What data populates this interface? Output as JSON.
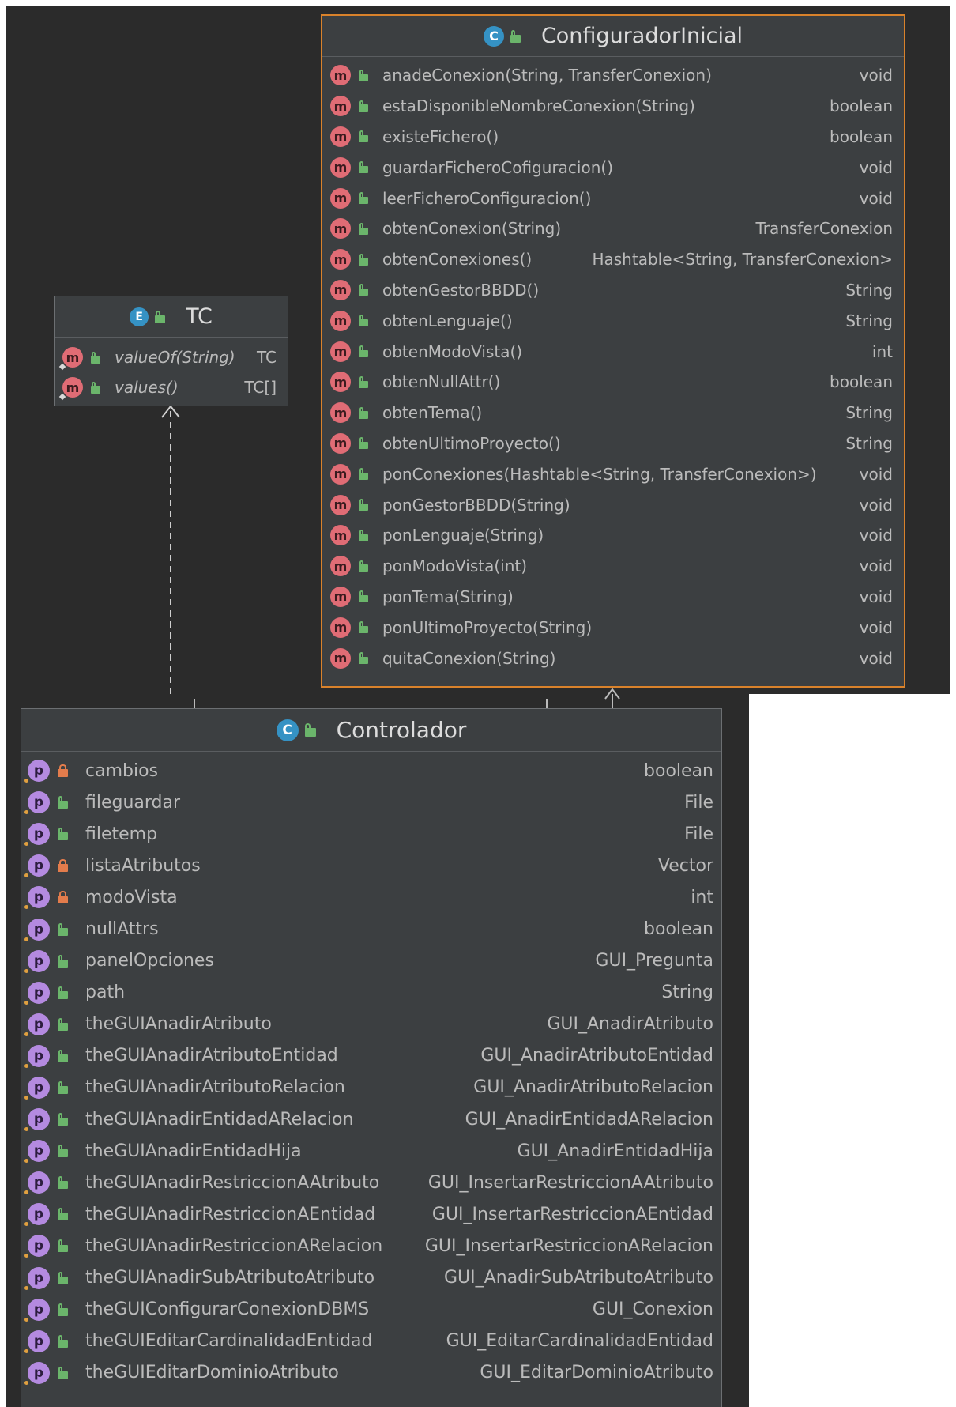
{
  "configurador": {
    "title": "ConfiguradorInicial",
    "kind_icon": "class-icon",
    "methods": [
      {
        "name": "anadeConexion(String, TransferConexion)",
        "type": "void"
      },
      {
        "name": "estaDisponibleNombreConexion(String)",
        "type": "boolean"
      },
      {
        "name": "existeFichero()",
        "type": "boolean"
      },
      {
        "name": "guardarFicheroCofiguracion()",
        "type": "void"
      },
      {
        "name": "leerFicheroConfiguracion()",
        "type": "void"
      },
      {
        "name": "obtenConexion(String)",
        "type": "TransferConexion"
      },
      {
        "name": "obtenConexiones()",
        "type": "Hashtable<String, TransferConexion>"
      },
      {
        "name": "obtenGestorBBDD()",
        "type": "String"
      },
      {
        "name": "obtenLenguaje()",
        "type": "String"
      },
      {
        "name": "obtenModoVista()",
        "type": "int"
      },
      {
        "name": "obtenNullAttr()",
        "type": "boolean"
      },
      {
        "name": "obtenTema()",
        "type": "String"
      },
      {
        "name": "obtenUltimoProyecto()",
        "type": "String"
      },
      {
        "name": "ponConexiones(Hashtable<String, TransferConexion>)",
        "type": "void"
      },
      {
        "name": "ponGestorBBDD(String)",
        "type": "void"
      },
      {
        "name": "ponLenguaje(String)",
        "type": "void"
      },
      {
        "name": "ponModoVista(int)",
        "type": "void"
      },
      {
        "name": "ponTema(String)",
        "type": "void"
      },
      {
        "name": "ponUltimoProyecto(String)",
        "type": "void"
      },
      {
        "name": "quitaConexion(String)",
        "type": "void"
      }
    ]
  },
  "tc": {
    "title": "TC",
    "kind_icon": "enum-icon",
    "methods": [
      {
        "name": "valueOf(String)",
        "type": "TC"
      },
      {
        "name": "values()",
        "type": "TC[]"
      }
    ]
  },
  "controlador": {
    "title": "Controlador",
    "kind_icon": "class-icon",
    "fields": [
      {
        "name": "cambios",
        "type": "boolean",
        "access": "private"
      },
      {
        "name": "fileguardar",
        "type": "File",
        "access": "public"
      },
      {
        "name": "filetemp",
        "type": "File",
        "access": "public"
      },
      {
        "name": "listaAtributos",
        "type": "Vector",
        "access": "private"
      },
      {
        "name": "modoVista",
        "type": "int",
        "access": "private"
      },
      {
        "name": "nullAttrs",
        "type": "boolean",
        "access": "public"
      },
      {
        "name": "panelOpciones",
        "type": "GUI_Pregunta",
        "access": "public"
      },
      {
        "name": "path",
        "type": "String",
        "access": "public"
      },
      {
        "name": "theGUIAnadirAtributo",
        "type": "GUI_AnadirAtributo",
        "access": "public"
      },
      {
        "name": "theGUIAnadirAtributoEntidad",
        "type": "GUI_AnadirAtributoEntidad",
        "access": "public"
      },
      {
        "name": "theGUIAnadirAtributoRelacion",
        "type": "GUI_AnadirAtributoRelacion",
        "access": "public"
      },
      {
        "name": "theGUIAnadirEntidadARelacion",
        "type": "GUI_AnadirEntidadARelacion",
        "access": "public"
      },
      {
        "name": "theGUIAnadirEntidadHija",
        "type": "GUI_AnadirEntidadHija",
        "access": "public"
      },
      {
        "name": "theGUIAnadirRestriccionAAtributo",
        "type": "GUI_InsertarRestriccionAAtributo",
        "access": "public"
      },
      {
        "name": "theGUIAnadirRestriccionAEntidad",
        "type": "GUI_InsertarRestriccionAEntidad",
        "access": "public"
      },
      {
        "name": "theGUIAnadirRestriccionARelacion",
        "type": "GUI_InsertarRestriccionARelacion",
        "access": "public"
      },
      {
        "name": "theGUIAnadirSubAtributoAtributo",
        "type": "GUI_AnadirSubAtributoAtributo",
        "access": "public"
      },
      {
        "name": "theGUIConfigurarConexionDBMS",
        "type": "GUI_Conexion",
        "access": "public"
      },
      {
        "name": "theGUIEditarCardinalidadEntidad",
        "type": "GUI_EditarCardinalidadEntidad",
        "access": "public"
      },
      {
        "name": "theGUIEditarDominioAtributo",
        "type": "GUI_EditarDominioAtributo",
        "access": "public"
      }
    ]
  },
  "icons": {
    "method": "m",
    "property": "p",
    "class": "C",
    "enum": "E"
  },
  "colors": {
    "canvas": "#2b2b2b",
    "box": "#3c3f41",
    "selected_border": "#d9822b",
    "text": "#bbbbbb",
    "method_icon": "#e06c75",
    "property_icon": "#b48ae0",
    "class_icon": "#3592c4",
    "public_lock": "#6bb56b",
    "private_lock": "#e37c4c"
  }
}
